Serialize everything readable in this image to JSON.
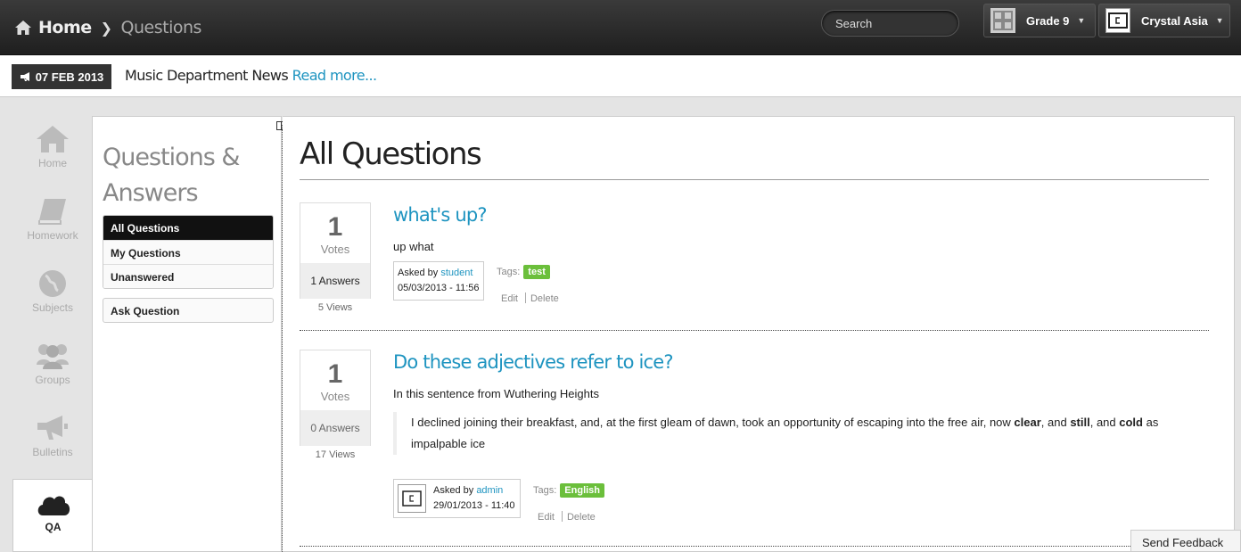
{
  "topbar": {
    "home": "Home",
    "current": "Questions",
    "search_placeholder": "Search",
    "grade": "Grade 9",
    "user": "Crystal Asia"
  },
  "news": {
    "date": "07 FEB 2013",
    "text": "Music Department News",
    "more": "Read more..."
  },
  "nav": [
    {
      "label": "Home",
      "icon": "home-icon"
    },
    {
      "label": "Homework",
      "icon": "book-icon"
    },
    {
      "label": "Subjects",
      "icon": "globe-icon"
    },
    {
      "label": "Groups",
      "icon": "users-icon"
    },
    {
      "label": "Bulletins",
      "icon": "megaphone-icon"
    },
    {
      "label": "QA",
      "icon": "cloud-icon"
    }
  ],
  "sidebar": {
    "title_line1": "Questions &",
    "title_line2": "Answers",
    "items": [
      "All Questions",
      "My Questions",
      "Unanswered"
    ],
    "ask": "Ask Question"
  },
  "main": {
    "title": "All Questions",
    "questions": [
      {
        "votes": "1",
        "votes_label": "Votes",
        "answers": "1 Answers",
        "views": "5 Views",
        "title": "what's up?",
        "body": "up what",
        "asked_by_label": "Asked by",
        "asked_by": "student",
        "date": "05/03/2013 - 11:56",
        "tags_label": "Tags:",
        "tag": "test",
        "edit": "Edit",
        "delete": "Delete"
      },
      {
        "votes": "1",
        "votes_label": "Votes",
        "answers": "0 Answers",
        "views": "17 Views",
        "title": "Do these adjectives refer to ice?",
        "body": "In this sentence from Wuthering Heights",
        "quote_pre": "I declined joining their breakfast, and, at the first gleam of dawn, took an opportunity of escaping into the free air, now ",
        "quote_b1": "clear",
        "quote_mid1": ", and ",
        "quote_b2": "still",
        "quote_mid2": ", and ",
        "quote_b3": "cold",
        "quote_post": " as impalpable ice",
        "asked_by_label": "Asked by",
        "asked_by": "admin",
        "date": "29/01/2013 - 11:40",
        "tags_label": "Tags:",
        "tag": "English",
        "edit": "Edit",
        "delete": "Delete"
      }
    ]
  },
  "feedback": "Send Feedback",
  "colors": {
    "accent": "#1e94c0",
    "tag": "#6bbf3b",
    "topbar": "#262626"
  }
}
